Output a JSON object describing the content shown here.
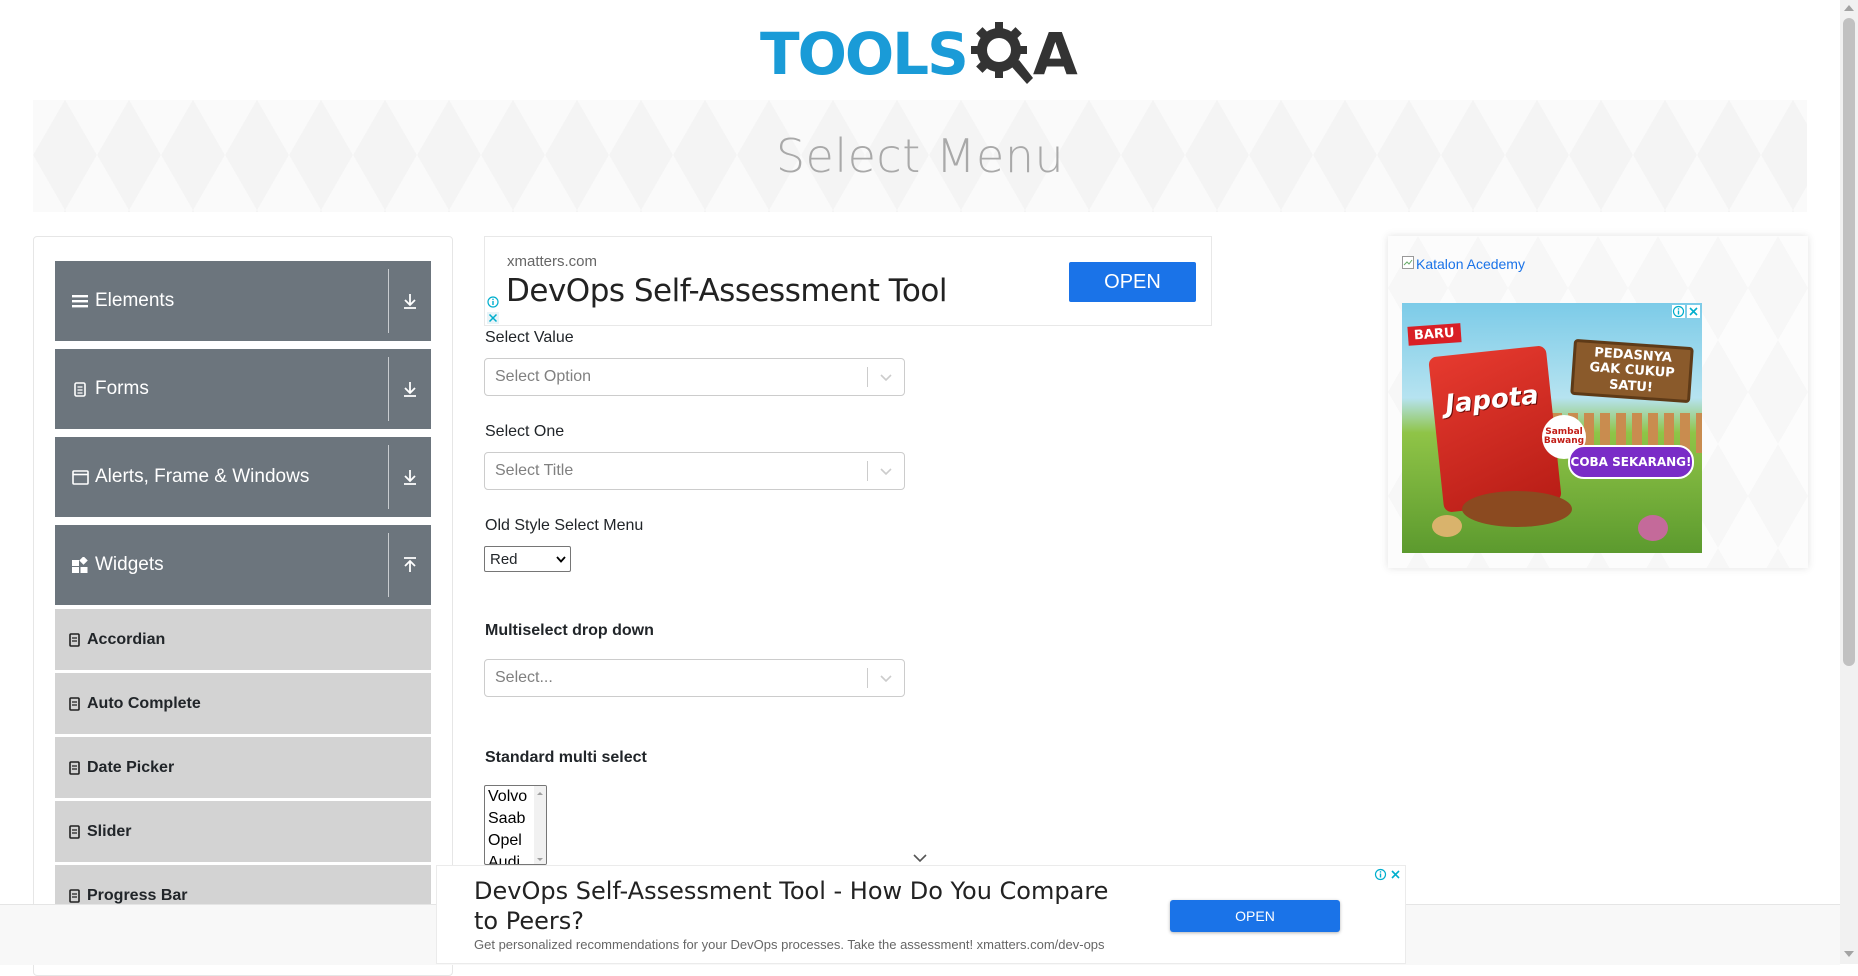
{
  "header": {
    "logo_text": "TOOLS",
    "logo_suffix": "A",
    "page_title": "Select Menu"
  },
  "sidebar": {
    "groups": [
      {
        "label": "Elements",
        "icon": "hamburger-icon",
        "state": "collapsed"
      },
      {
        "label": "Forms",
        "icon": "document-icon",
        "state": "collapsed"
      },
      {
        "label": "Alerts, Frame & Windows",
        "icon": "window-icon",
        "state": "collapsed"
      },
      {
        "label": "Widgets",
        "icon": "widgets-grid-icon",
        "state": "expanded"
      }
    ],
    "widgets_items": [
      {
        "label": "Accordian"
      },
      {
        "label": "Auto Complete"
      },
      {
        "label": "Date Picker"
      },
      {
        "label": "Slider"
      },
      {
        "label": "Progress Bar"
      }
    ]
  },
  "top_ad": {
    "domain": "xmatters.com",
    "headline": "DevOps Self-Assessment Tool",
    "button": "OPEN"
  },
  "form": {
    "select_value": {
      "label": "Select Value",
      "placeholder": "Select Option"
    },
    "select_one": {
      "label": "Select One",
      "placeholder": "Select Title"
    },
    "old_style": {
      "label": "Old Style Select Menu",
      "selected": "Red"
    },
    "multiselect": {
      "label": "Multiselect drop down",
      "placeholder": "Select..."
    },
    "standard_multi": {
      "label": "Standard multi select",
      "options": [
        "Volvo",
        "Saab",
        "Opel",
        "Audi"
      ]
    }
  },
  "right_ad": {
    "alt_link": "Katalon Acedemy",
    "creative": {
      "badge": "BARU",
      "brand": "Japota",
      "flavor": "Sambal Bawang",
      "sign": "PEDASNYA GAK CUKUP SATU!",
      "cta": "COBA SEKARANG!"
    }
  },
  "bottom_ad": {
    "headline": "DevOps Self-Assessment Tool - How Do You Compare to Peers?",
    "description": "Get personalized recommendations for your DevOps processes. Take the assessment! xmatters.com/dev-ops",
    "button": "OPEN"
  },
  "colors": {
    "accent_blue": "#1a9bd7",
    "sidebar_group_bg": "#6c757d",
    "sidebar_item_bg": "#d3d3d3",
    "ad_button": "#1a73e8"
  }
}
